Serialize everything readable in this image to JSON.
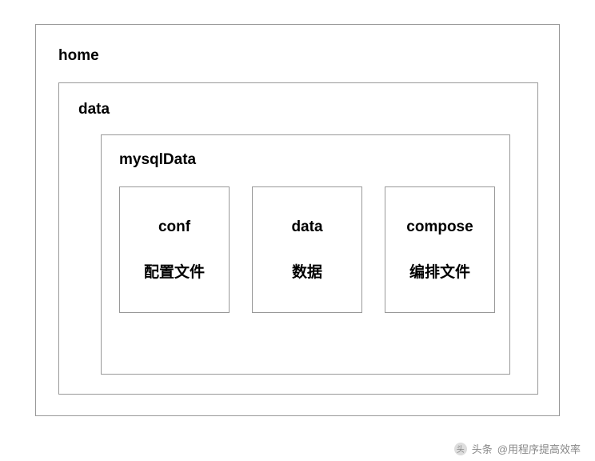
{
  "diagram": {
    "outer": {
      "label": "home"
    },
    "level2": {
      "label": "data"
    },
    "level3": {
      "label": "mysqlData"
    },
    "items": [
      {
        "name": "conf",
        "desc": "配置文件"
      },
      {
        "name": "data",
        "desc": "数据"
      },
      {
        "name": "compose",
        "desc": "编排文件"
      }
    ]
  },
  "footer": {
    "prefix": "头条",
    "author": "@用程序提高效率"
  }
}
